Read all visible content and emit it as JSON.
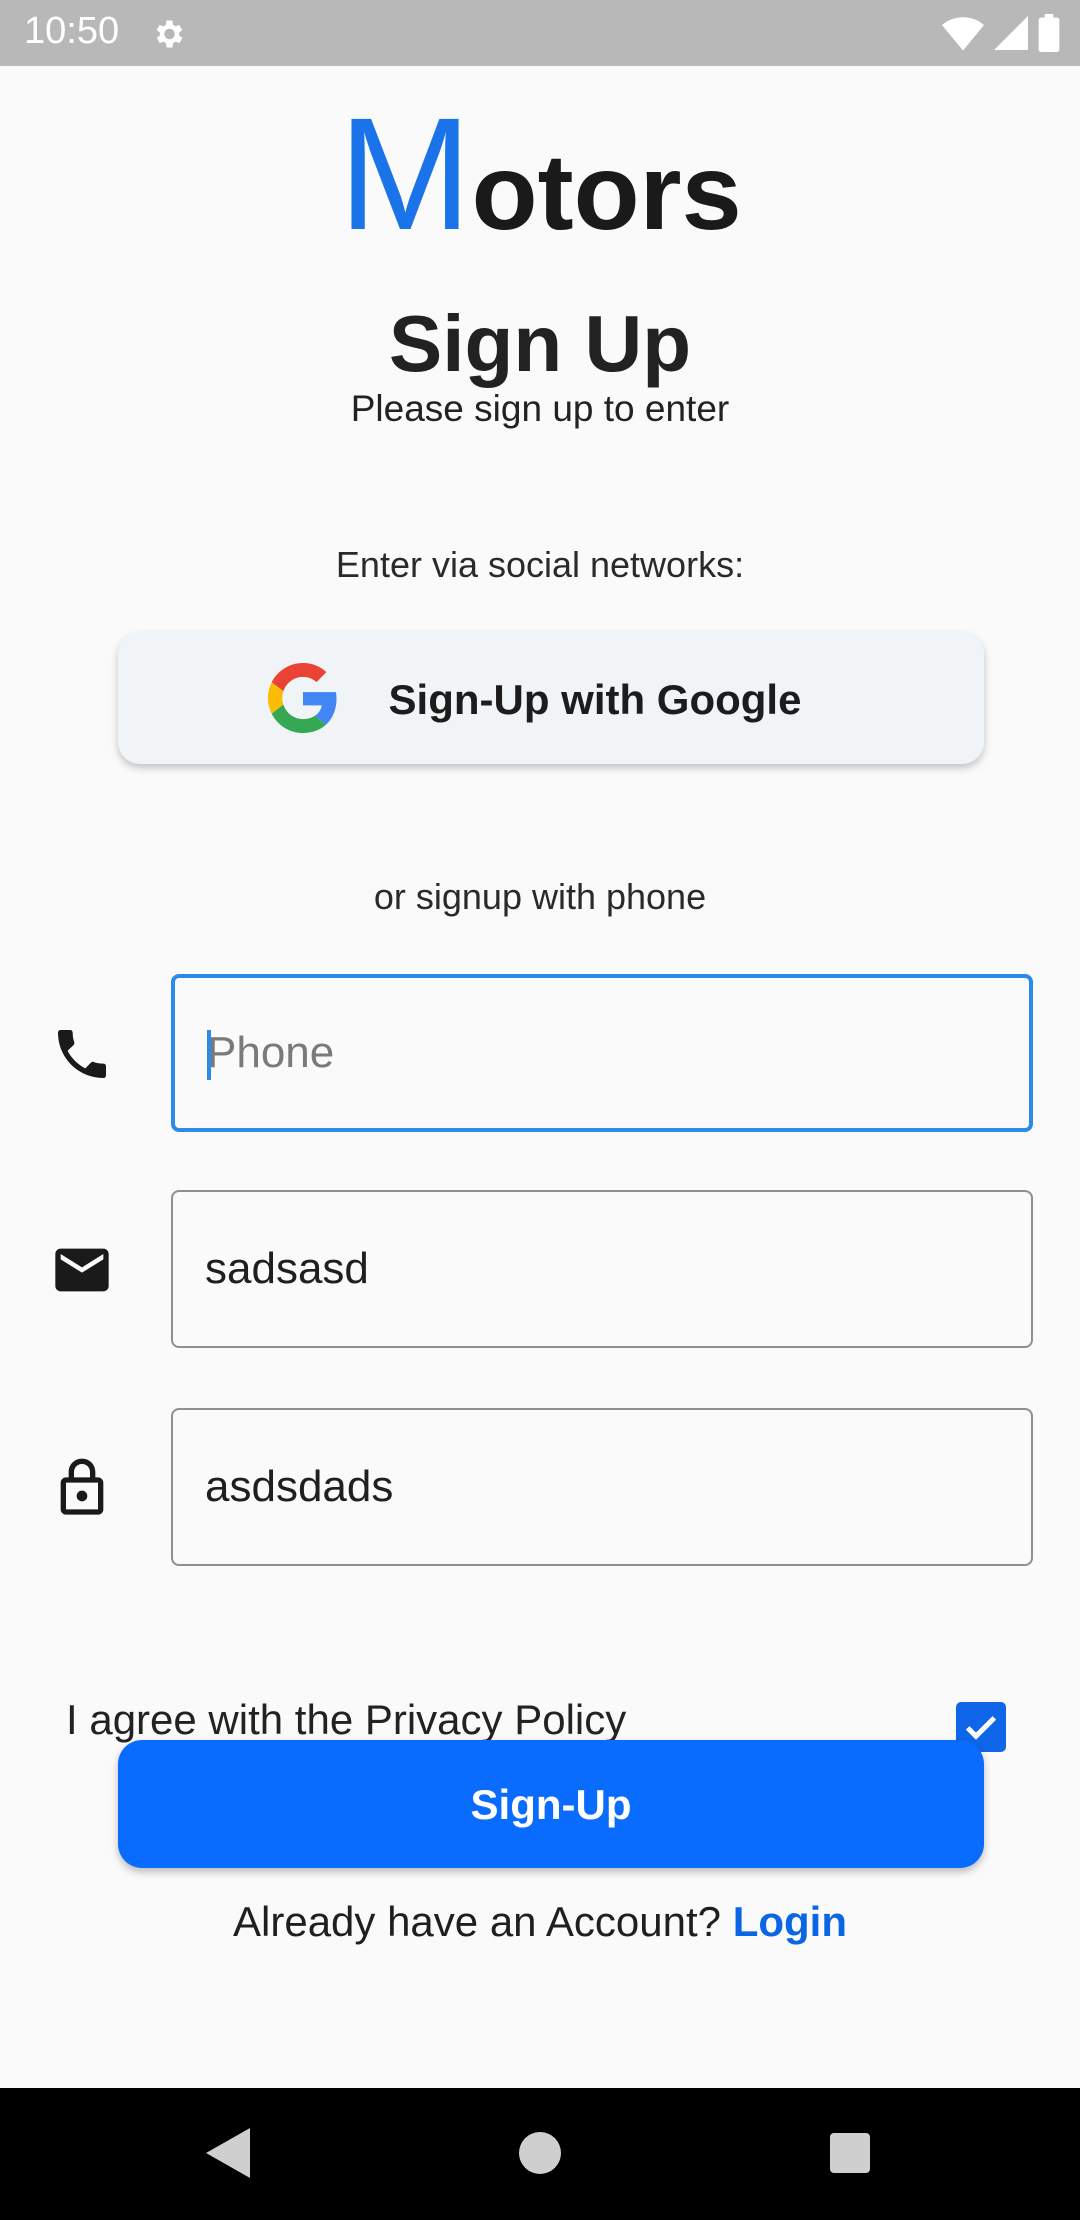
{
  "status_bar": {
    "time": "10:50"
  },
  "logo": {
    "first_letter": "M",
    "rest": "otors",
    "accent_color": "#1a73e8"
  },
  "header": {
    "title": "Sign Up",
    "subtitle": "Please sign up to enter"
  },
  "social": {
    "label": "Enter via social networks:",
    "google_button_label": "Sign-Up with Google"
  },
  "phone_section": {
    "label": "or signup with phone"
  },
  "form": {
    "phone": {
      "placeholder": "Phone",
      "value": ""
    },
    "email": {
      "placeholder": "",
      "value": "sadsasd"
    },
    "password": {
      "placeholder": "",
      "value": "asdsdads"
    },
    "privacy": {
      "label": "I agree with the Privacy Policy",
      "checked": true
    },
    "submit_label": "Sign-Up"
  },
  "footer": {
    "prompt": "Already have an Account?",
    "login_label": "Login"
  },
  "colors": {
    "primary": "#0a6cff",
    "focus_border": "#2b8bea",
    "link": "#0b66e4",
    "background": "#fafafa"
  },
  "icons": {
    "status_settings": "gear-icon",
    "status_wifi": "wifi-icon",
    "status_signal": "cell-signal-icon",
    "status_battery": "battery-icon",
    "google": "google-icon",
    "phone": "phone-icon",
    "email": "mail-icon",
    "password": "lock-icon",
    "checkbox": "checkmark-icon",
    "nav_back": "back-triangle-icon",
    "nav_home": "home-circle-icon",
    "nav_recents": "recents-square-icon"
  }
}
